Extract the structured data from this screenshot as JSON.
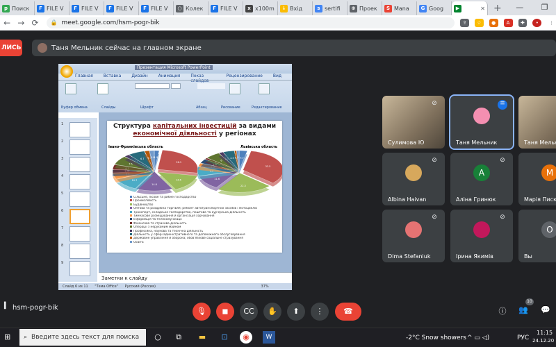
{
  "browser": {
    "tabs": [
      {
        "label": "Поиск",
        "color": "#34a853",
        "glyph": "p"
      },
      {
        "label": "FILE V",
        "color": "#1a73e8",
        "glyph": "F"
      },
      {
        "label": "FILE V",
        "color": "#1a73e8",
        "glyph": "F"
      },
      {
        "label": "FILE V",
        "color": "#1a73e8",
        "glyph": "F"
      },
      {
        "label": "FILE V",
        "color": "#1a73e8",
        "glyph": "F"
      },
      {
        "label": "Колек",
        "color": "#5f6368",
        "glyph": "○"
      },
      {
        "label": "FILE V",
        "color": "#1a73e8",
        "glyph": "F"
      },
      {
        "label": "x100m",
        "color": "#444",
        "glyph": "x"
      },
      {
        "label": "Вхід",
        "color": "#fbbc04",
        "glyph": "↓"
      },
      {
        "label": "sertifi",
        "color": "#4285f4",
        "glyph": "s"
      },
      {
        "label": "Проек",
        "color": "#5f6368",
        "glyph": "⊕"
      },
      {
        "label": "Mana",
        "color": "#ea4335",
        "glyph": "S"
      },
      {
        "label": "Goog",
        "color": "#4285f4",
        "glyph": "G"
      },
      {
        "label": "",
        "color": "#00832d",
        "glyph": "▶",
        "active": true
      }
    ],
    "new_tab": "+",
    "url": "meet.google.com/hsm-pogr-bik"
  },
  "meet": {
    "leave_label": "ЛИСЬ",
    "presenting_text": "Таня Мельник сейчас на главном экране",
    "meeting_code": "hsm-pogr-bik",
    "people_count": "10"
  },
  "powerpoint": {
    "title_text": "Презентация Microsoft PowerPoint",
    "ribbon_tabs": [
      "Главная",
      "Вставка",
      "Дизайн",
      "Анимация",
      "Показ слайдов",
      "Рецензирование",
      "Вид"
    ],
    "groups": [
      "Буфер обмена",
      "Слайды",
      "Шрифт",
      "Абзац",
      "Рисование",
      "Редактирование"
    ],
    "notes_placeholder": "Заметки к слайду",
    "status": [
      "Слайд 6 из 11",
      "\"Тема Office\"",
      "Русский (Россия)",
      "37%"
    ],
    "slide": {
      "title_plain": "Структура ",
      "title_underlined": "капітальних інвестицій",
      "title_after": " за видами",
      "title_line2": "економічної діяльності",
      "title_line3_after": " у регіонах",
      "region_left": "Івано-Франківська область",
      "region_right": "Львівська область"
    }
  },
  "chart_data": [
    {
      "type": "pie",
      "title": "Івано-Франківська область",
      "categories": [
        "Сільське, лісове та рибне господарство",
        "Промисловість",
        "Будівництво",
        "Оптова та роздрібна торгівля; ремонт автотранспортних засобів і мотоциклів",
        "Транспорт, складське господарство, поштова та кур'єрська діяльність",
        "Тимчасове розміщування й організація харчування",
        "Інформація та телекомунікації",
        "Фінансова та страхова діяльність",
        "Операції з нерухомим майном",
        "Професійна, наукова та технічна діяльність",
        "Діяльність у сфері адміністративного та допоміжного обслуговування",
        "Державне управління й оборона; обов'язкове соціальне страхування",
        "Освіта"
      ],
      "values": [
        1.9,
        26.1,
        14.6,
        14.8,
        10.7,
        5.2,
        2.5,
        4.1,
        7.5,
        2.1,
        6.7,
        1.9,
        1.9
      ]
    },
    {
      "type": "pie",
      "title": "Львівська область",
      "categories": [
        "Сільське, лісове та рибне господарство",
        "Промисловість",
        "Будівництво",
        "Оптова та роздрібна торгівля; ремонт автотранспортних засобів і мотоциклів",
        "Транспорт, складське господарство, поштова та кур'єрська діяльність",
        "Тимчасове розміщування й організація харчування",
        "Інформація та телекомунікації",
        "Фінансова та страхова діяльність",
        "Операції з нерухомим майном",
        "Професійна, наукова та технічна діяльність",
        "Діяльність у сфері адміністративного та допоміжного обслуговування",
        "Державне управління й оборона; обов'язкове соціальне страхування",
        "Освіта"
      ],
      "values": [
        3.2,
        33.5,
        22.3,
        11.6,
        7.7,
        2.8,
        3.6,
        1.2,
        6.0,
        1.8,
        4.5,
        0.8,
        1.0
      ]
    }
  ],
  "chart_colors": [
    "#4f81bd",
    "#c0504d",
    "#9bbb59",
    "#8064a2",
    "#4bacc6",
    "#f79646",
    "#2c4d75",
    "#772c2a",
    "#5f7530",
    "#4d3b62",
    "#276a7c",
    "#b65708",
    "#729aca"
  ],
  "participants": [
    {
      "name": "Сулимова Ю",
      "kind": "video",
      "muted": true
    },
    {
      "name": "Таня Мельник",
      "kind": "avatar-photo",
      "speaking": true,
      "color": "#f48fb1"
    },
    {
      "name": "Таня Мельник",
      "kind": "video",
      "muted": false
    },
    {
      "name": "Albina Haivan",
      "kind": "avatar-photo",
      "muted": true,
      "color": "#d7a85c"
    },
    {
      "name": "Аліна Гринюк",
      "kind": "letter",
      "letter": "A",
      "muted": true,
      "color": "#188038"
    },
    {
      "name": "Марія Писк",
      "kind": "letter",
      "letter": "M",
      "muted": true,
      "color": "#e8710a"
    },
    {
      "name": "Dima Stefaniuk",
      "kind": "avatar-photo",
      "muted": true,
      "color": "#e57373"
    },
    {
      "name": "Ірина Якимів",
      "kind": "avatar-photo",
      "muted": true,
      "color": "#c2185b"
    },
    {
      "name": "Вы",
      "kind": "letter",
      "letter": "O",
      "muted": true,
      "color": "#5f6368"
    }
  ],
  "taskbar": {
    "search_placeholder": "Введите здесь текст для поиска",
    "weather": "-2°C  Snow showers",
    "lang": "РУС",
    "time": "11:15",
    "date": "24.12.20"
  }
}
